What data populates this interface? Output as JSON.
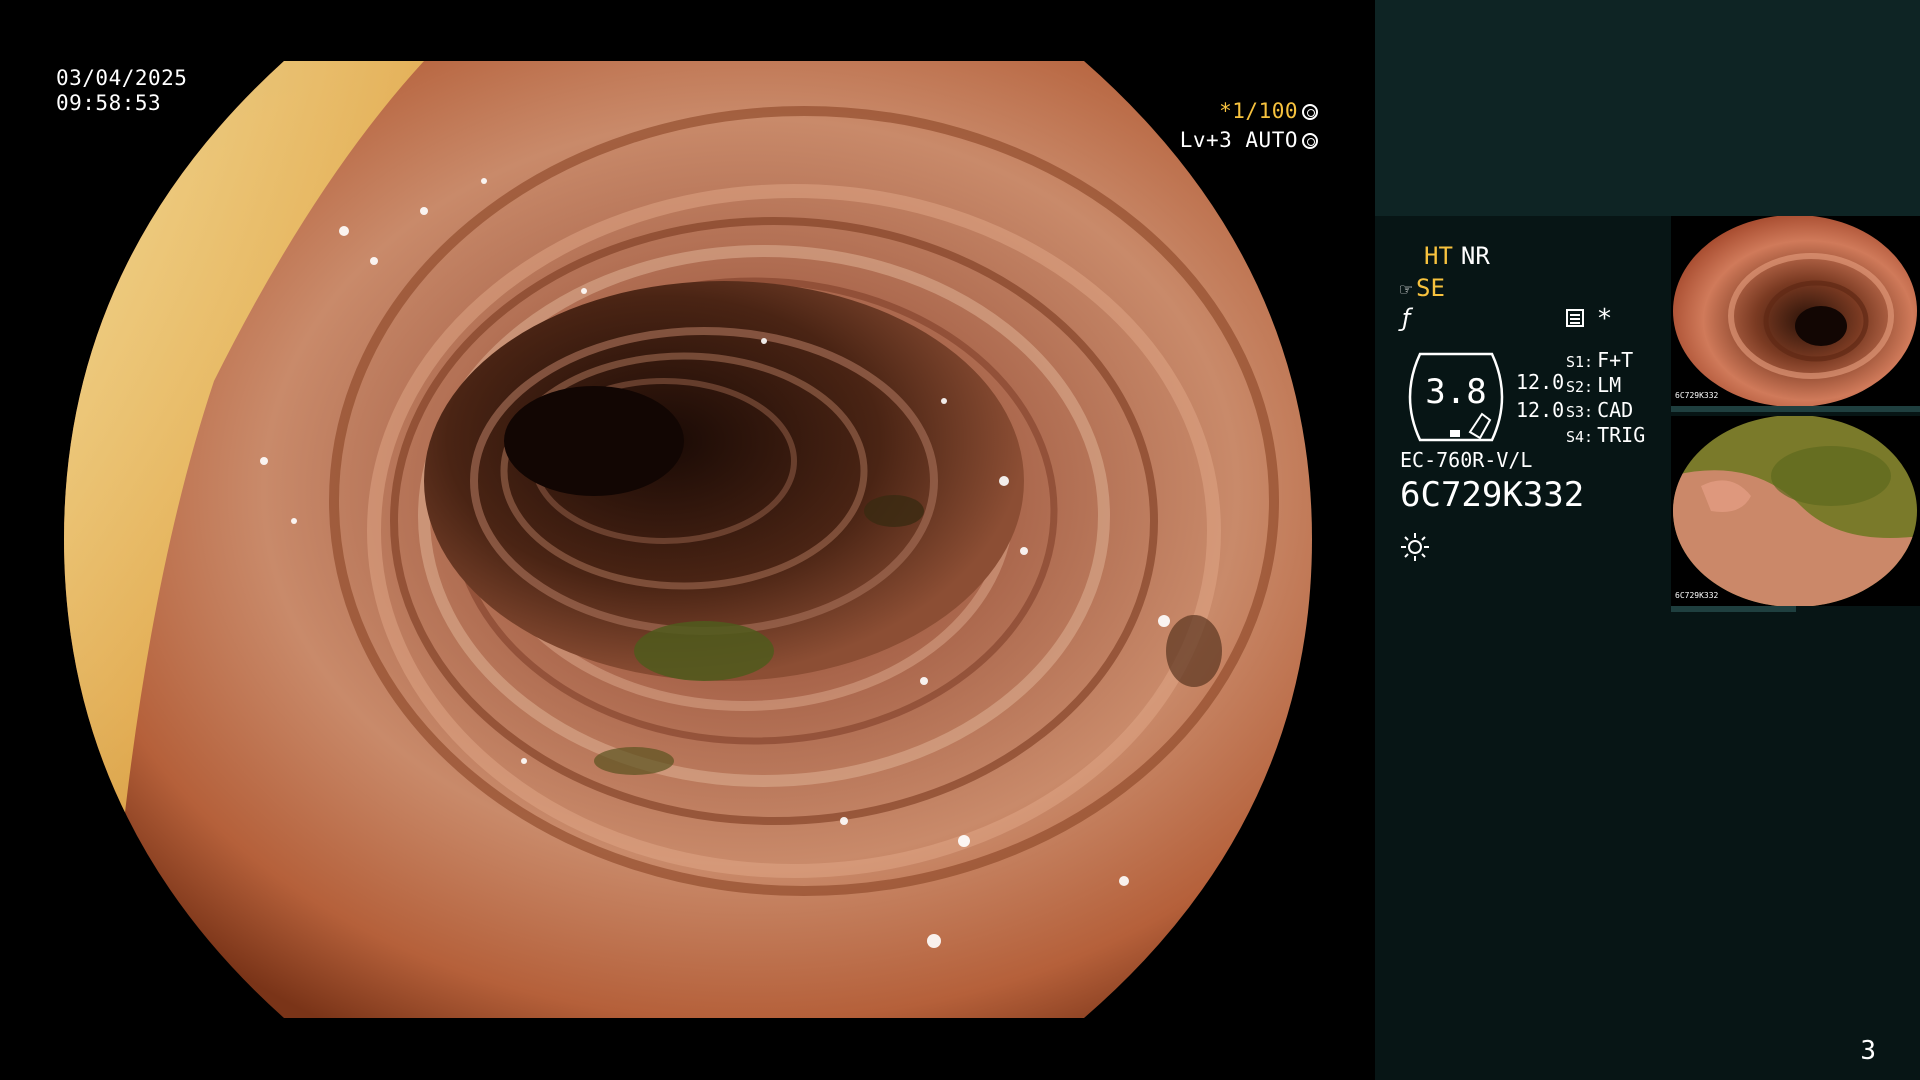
{
  "overlay": {
    "date": "03/04/2025",
    "time": "09:58:53",
    "shutter": "*1/100",
    "level": "Lv+3 AUTO"
  },
  "panel": {
    "ht": "HT",
    "nr": "NR",
    "se": "SE",
    "gauge_value": "3.8",
    "values": [
      "12.0",
      "12.0"
    ],
    "switches": [
      {
        "key": "S1:",
        "value": "F+T"
      },
      {
        "key": "S2:",
        "value": "LM"
      },
      {
        "key": "S3:",
        "value": "CAD"
      },
      {
        "key": "S4:",
        "value": "TRIG"
      }
    ],
    "model": "EC-760R-V/L",
    "serial": "6C729K332"
  },
  "thumbnails": [
    {
      "label": "6C729K332"
    },
    {
      "label": "6C729K332"
    }
  ],
  "page_number": "3",
  "colors": {
    "accent_yellow": "#f7c23e",
    "panel_top": "#0e2424",
    "panel_bottom": "#071515"
  }
}
